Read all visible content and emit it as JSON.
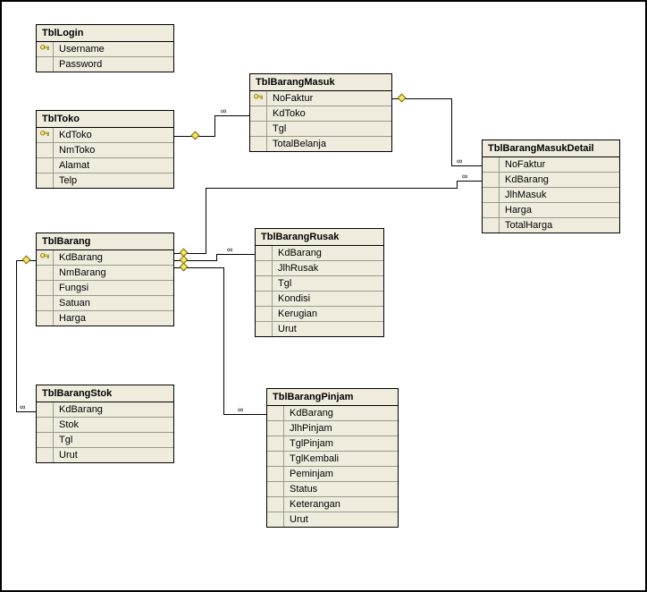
{
  "tables": {
    "login": {
      "title": "TblLogin",
      "fields": [
        {
          "name": "Username",
          "pk": true
        },
        {
          "name": "Password",
          "pk": false
        }
      ]
    },
    "toko": {
      "title": "TblToko",
      "fields": [
        {
          "name": "KdToko",
          "pk": true
        },
        {
          "name": "NmToko",
          "pk": false
        },
        {
          "name": "Alamat",
          "pk": false
        },
        {
          "name": "Telp",
          "pk": false
        }
      ]
    },
    "barang": {
      "title": "TblBarang",
      "fields": [
        {
          "name": "KdBarang",
          "pk": true
        },
        {
          "name": "NmBarang",
          "pk": false
        },
        {
          "name": "Fungsi",
          "pk": false
        },
        {
          "name": "Satuan",
          "pk": false
        },
        {
          "name": "Harga",
          "pk": false
        }
      ]
    },
    "barangStok": {
      "title": "TblBarangStok",
      "fields": [
        {
          "name": "KdBarang",
          "pk": false
        },
        {
          "name": "Stok",
          "pk": false
        },
        {
          "name": "Tgl",
          "pk": false
        },
        {
          "name": "Urut",
          "pk": false
        }
      ]
    },
    "barangMasuk": {
      "title": "TblBarangMasuk",
      "fields": [
        {
          "name": "NoFaktur",
          "pk": true
        },
        {
          "name": "KdToko",
          "pk": false
        },
        {
          "name": "Tgl",
          "pk": false
        },
        {
          "name": "TotalBelanja",
          "pk": false
        }
      ]
    },
    "barangMasukDetail": {
      "title": "TblBarangMasukDetail",
      "fields": [
        {
          "name": "NoFaktur",
          "pk": false
        },
        {
          "name": "KdBarang",
          "pk": false
        },
        {
          "name": "JlhMasuk",
          "pk": false
        },
        {
          "name": "Harga",
          "pk": false
        },
        {
          "name": "TotalHarga",
          "pk": false
        }
      ]
    },
    "barangRusak": {
      "title": "TblBarangRusak",
      "fields": [
        {
          "name": "KdBarang",
          "pk": false
        },
        {
          "name": "JlhRusak",
          "pk": false
        },
        {
          "name": "Tgl",
          "pk": false
        },
        {
          "name": "Kondisi",
          "pk": false
        },
        {
          "name": "Kerugian",
          "pk": false
        },
        {
          "name": "Urut",
          "pk": false
        }
      ]
    },
    "barangPinjam": {
      "title": "TblBarangPinjam",
      "fields": [
        {
          "name": "KdBarang",
          "pk": false
        },
        {
          "name": "JlhPinjam",
          "pk": false
        },
        {
          "name": "TglPinjam",
          "pk": false
        },
        {
          "name": "TglKembali",
          "pk": false
        },
        {
          "name": "Peminjam",
          "pk": false
        },
        {
          "name": "Status",
          "pk": false
        },
        {
          "name": "Keterangan",
          "pk": false
        },
        {
          "name": "Urut",
          "pk": false
        }
      ]
    }
  },
  "relationships": [
    {
      "from": "TblToko.KdToko",
      "to": "TblBarangMasuk.KdToko"
    },
    {
      "from": "TblBarangMasuk.NoFaktur",
      "to": "TblBarangMasukDetail.NoFaktur"
    },
    {
      "from": "TblBarang.KdBarang",
      "to": "TblBarangMasukDetail.KdBarang"
    },
    {
      "from": "TblBarang.KdBarang",
      "to": "TblBarangRusak.KdBarang"
    },
    {
      "from": "TblBarang.KdBarang",
      "to": "TblBarangPinjam.KdBarang"
    },
    {
      "from": "TblBarang.KdBarang",
      "to": "TblBarangStok.KdBarang"
    }
  ]
}
